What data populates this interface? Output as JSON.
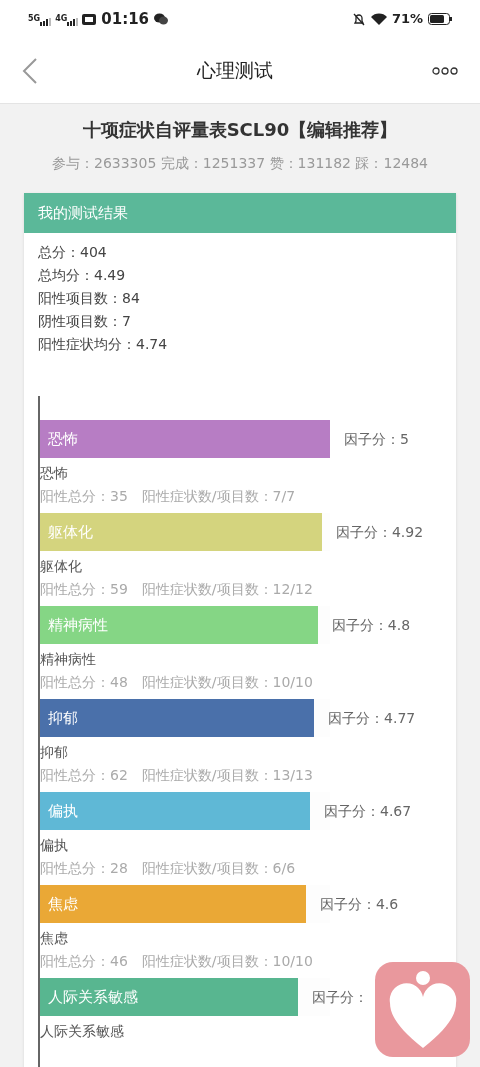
{
  "status_bar": {
    "network_1": "5G",
    "network_2": "4G",
    "time": "01:16",
    "battery": "71%"
  },
  "header": {
    "title": "心理测试"
  },
  "test": {
    "title": "十项症状自评量表SCL90【编辑推荐】",
    "stats": "参与：2633305 完成：1251337 赞：131182 踩：12484"
  },
  "result_card": {
    "title": "我的测试结果",
    "summary": [
      "总分：404",
      "总均分：4.49",
      "阳性项目数：84",
      "阴性项目数：7",
      "阳性症状均分：4.74"
    ],
    "factors": [
      {
        "name": "恐怖",
        "score": "因子分：5",
        "color": "#b77dc4",
        "level": 1.0,
        "caption": "恐怖",
        "detail": "阳性总分：35　阳性症状数/项目数：7/7"
      },
      {
        "name": "躯体化",
        "score": "因子分：4.92",
        "color": "#d4d47e",
        "level": 0.972,
        "caption": "躯体化",
        "detail": "阳性总分：59　阳性症状数/项目数：12/12"
      },
      {
        "name": "精神病性",
        "score": "因子分：4.8",
        "color": "#85d685",
        "level": 0.958,
        "caption": "精神病性",
        "detail": "阳性总分：48　阳性症状数/项目数：10/10"
      },
      {
        "name": "抑郁",
        "score": "因子分：4.77",
        "color": "#4a70aa",
        "level": 0.945,
        "caption": "抑郁",
        "detail": "阳性总分：62　阳性症状数/项目数：13/13"
      },
      {
        "name": "偏执",
        "score": "因子分：4.67",
        "color": "#5fb8d6",
        "level": 0.931,
        "caption": "偏执",
        "detail": "阳性总分：28　阳性症状数/项目数：6/6"
      },
      {
        "name": "焦虑",
        "score": "因子分：4.6",
        "color": "#eaa836",
        "level": 0.917,
        "caption": "焦虑",
        "detail": "阳性总分：46　阳性症状数/项目数：10/10"
      },
      {
        "name": "人际关系敏感",
        "score": "因子分：",
        "color": "#58b690",
        "level": 0.89,
        "caption": "人际关系敏感"
      }
    ]
  }
}
